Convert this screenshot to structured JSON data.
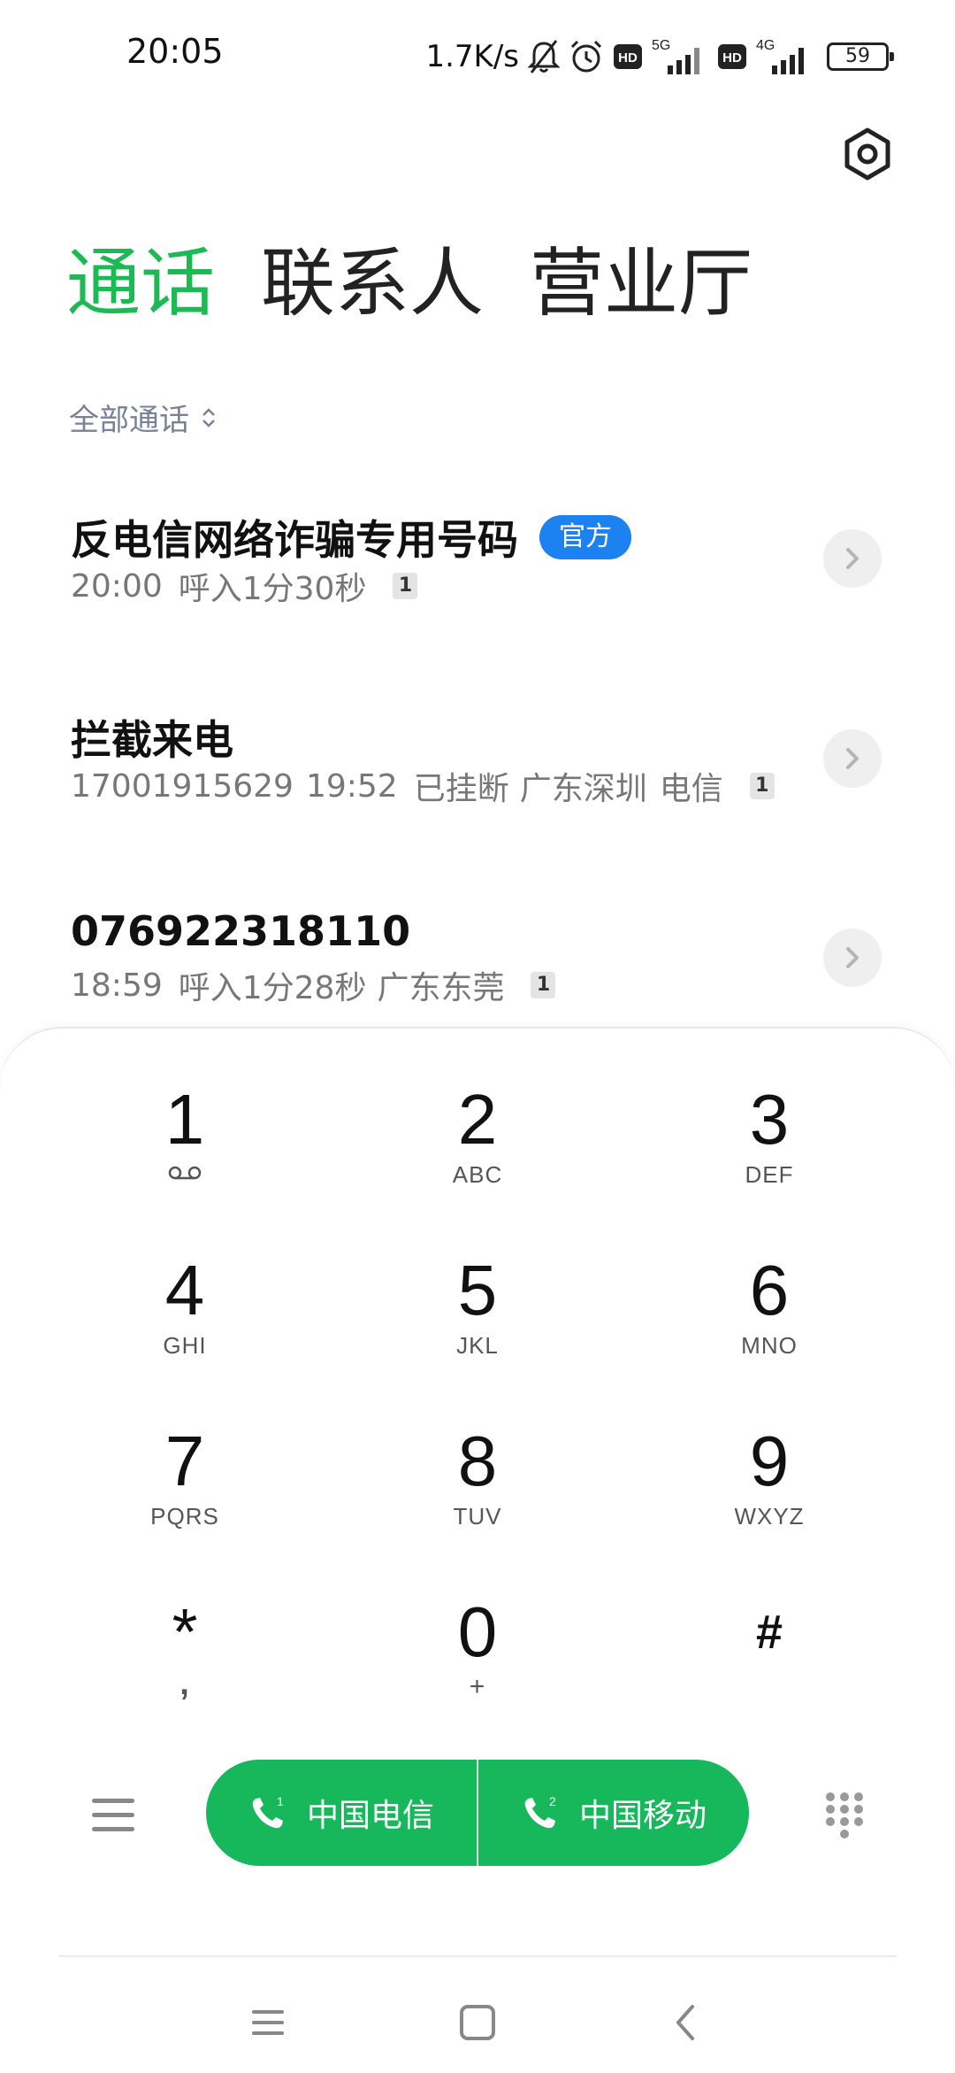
{
  "status_bar": {
    "time": "20:05",
    "net_speed": "1.7K/s",
    "hd_badge": "HD",
    "network_1": "5G",
    "network_2": "4G",
    "battery": "59"
  },
  "tabs": [
    {
      "label": "通话",
      "active": true
    },
    {
      "label": "联系人",
      "active": false
    },
    {
      "label": "营业厅",
      "active": false
    }
  ],
  "filter": {
    "label": "全部通话"
  },
  "calls": [
    {
      "title": "反电信网络诈骗专用号码",
      "badge": "官方",
      "number": "",
      "time": "20:00",
      "status": "呼入1分30秒",
      "location": "",
      "carrier": "",
      "sim": "1"
    },
    {
      "title": "拦截来电",
      "badge": "",
      "number": "17001915629",
      "time": "19:52",
      "status": "已挂断",
      "location": "广东深圳",
      "carrier": "电信",
      "sim": "1"
    },
    {
      "title": "076922318110",
      "badge": "",
      "number": "",
      "time": "18:59",
      "status": "呼入1分28秒",
      "location": "广东东莞",
      "carrier": "",
      "sim": "1"
    }
  ],
  "keypad": [
    {
      "digit": "1",
      "letters": ""
    },
    {
      "digit": "2",
      "letters": "ABC"
    },
    {
      "digit": "3",
      "letters": "DEF"
    },
    {
      "digit": "4",
      "letters": "GHI"
    },
    {
      "digit": "5",
      "letters": "JKL"
    },
    {
      "digit": "6",
      "letters": "MNO"
    },
    {
      "digit": "7",
      "letters": "PQRS"
    },
    {
      "digit": "8",
      "letters": "TUV"
    },
    {
      "digit": "9",
      "letters": "WXYZ"
    },
    {
      "digit": "*",
      "letters": ","
    },
    {
      "digit": "0",
      "letters": "+"
    },
    {
      "digit": "#",
      "letters": ""
    }
  ],
  "call_buttons": {
    "sim1_label": "中国电信",
    "sim2_label": "中国移动",
    "sim1_index": "1",
    "sim2_index": "2"
  },
  "colors": {
    "accent": "#1db954",
    "call_green": "#16b85b",
    "badge_blue": "#1c82f2"
  }
}
